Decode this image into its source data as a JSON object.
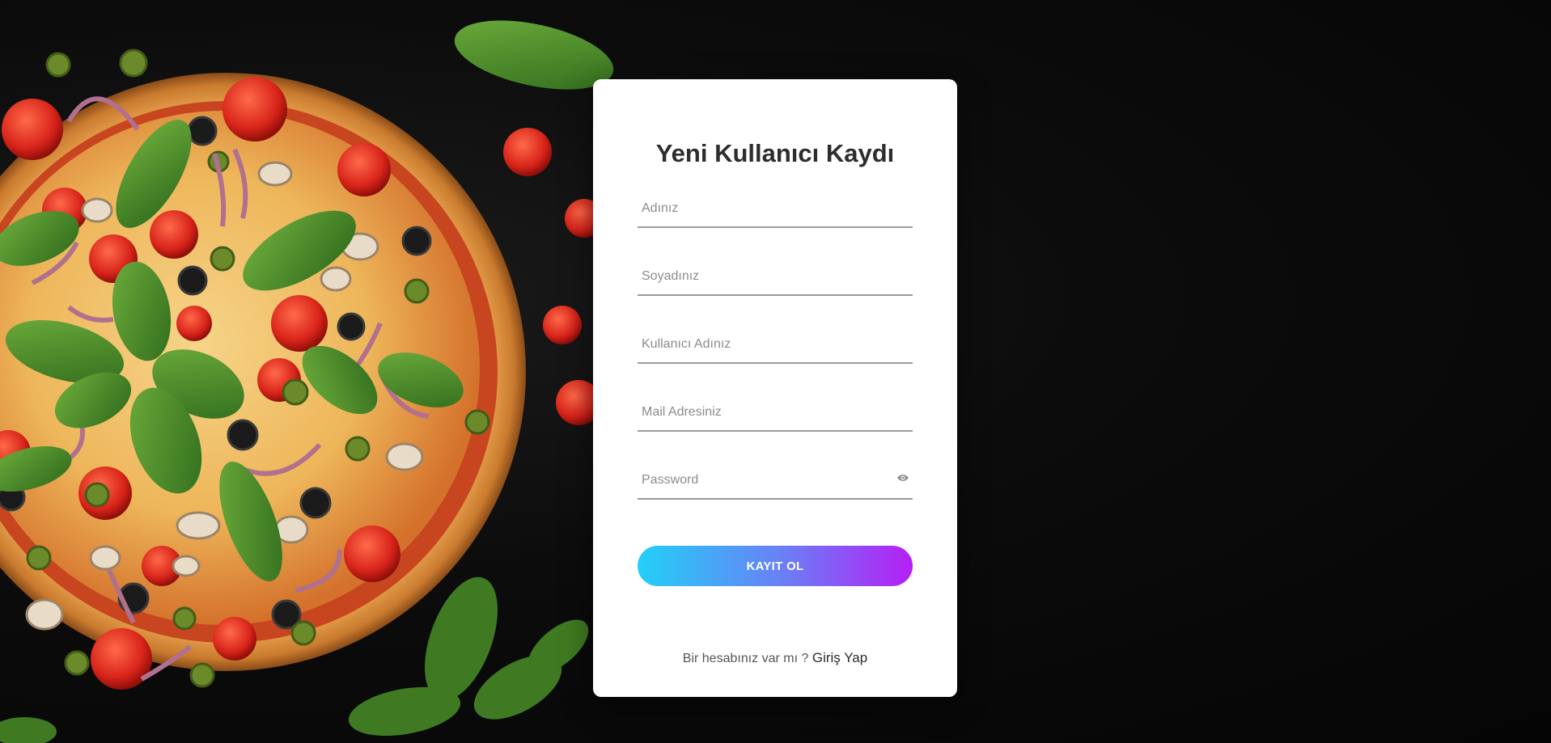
{
  "form": {
    "title": "Yeni Kullanıcı Kaydı",
    "fields": {
      "first_name": {
        "placeholder": "Adınız",
        "value": ""
      },
      "last_name": {
        "placeholder": "Soyadınız",
        "value": ""
      },
      "username": {
        "placeholder": "Kullanıcı Adınız",
        "value": ""
      },
      "email": {
        "placeholder": "Mail Adresiniz",
        "value": ""
      },
      "password": {
        "placeholder": "Password",
        "value": "",
        "toggle_icon": "eye-icon"
      }
    },
    "submit_label": "KAYIT OL",
    "footer": {
      "prompt": "Bir hesabınız var mı ?",
      "login_link": "Giriş Yap"
    }
  },
  "background": {
    "description_icon": "pizza-illustration"
  },
  "colors": {
    "card": "#ffffff",
    "title": "#2d2d2d",
    "button_gradient_start": "#22d0f7",
    "button_gradient_end": "#b61ff5",
    "page_background": "#0a0a0a"
  }
}
